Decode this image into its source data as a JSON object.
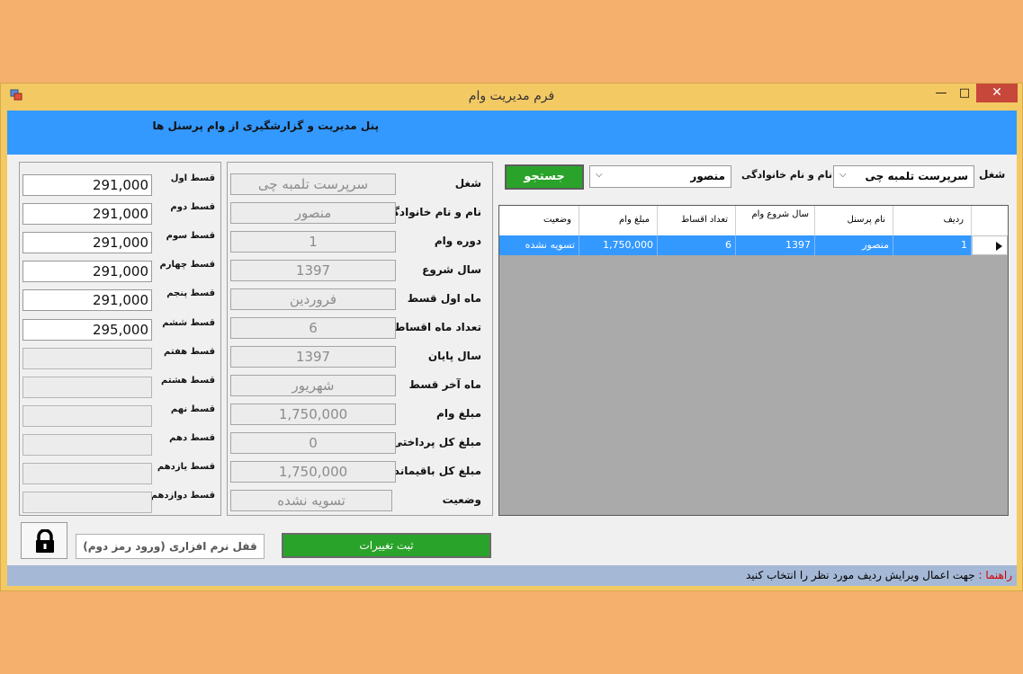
{
  "window": {
    "title": "فرم مدیریت وام",
    "controls": {
      "minimize": "—",
      "maximize": "□",
      "close": "✕"
    }
  },
  "banner": {
    "text": "پنل مدیریت و گزارشگیری از وام پرسنل ها"
  },
  "search": {
    "job_label": "شغل",
    "job_value": "سرپرست تلمبه چی",
    "name_label": "نام و نام خانوادگی",
    "name_value": "منصور",
    "button": "جستجو"
  },
  "grid": {
    "columns": [
      "ردیف",
      "نام پرسنل",
      "سال شروع وام",
      "تعداد اقساط",
      "مبلغ وام",
      "وضعیت"
    ],
    "rows": [
      {
        "index": "1",
        "name": "منصور",
        "start_year": "1397",
        "count": "6",
        "amount": "1,750,000",
        "status": "تسویه نشده"
      }
    ]
  },
  "details": {
    "fields": [
      {
        "label": "شغل",
        "value": "سرپرست تلمبه چی"
      },
      {
        "label": "نام و نام خانوادگی",
        "value": "منصور"
      },
      {
        "label": "دوره وام",
        "value": "1"
      },
      {
        "label": "سال شروع",
        "value": "1397"
      },
      {
        "label": "ماه اول قسط",
        "value": "فروردین"
      },
      {
        "label": "تعداد ماه اقساط",
        "value": "6"
      },
      {
        "label": "سال پایان",
        "value": "1397"
      },
      {
        "label": "ماه آخر قسط",
        "value": "شهریور"
      },
      {
        "label": "مبلغ وام",
        "value": "1,750,000"
      },
      {
        "label": "مبلغ کل پرداختی",
        "value": "0"
      },
      {
        "label": "مبلغ کل باقیمانده",
        "value": "1,750,000"
      },
      {
        "label": "وضعیت",
        "value": "تسویه نشده"
      }
    ]
  },
  "installments": {
    "items": [
      {
        "label": "قسط اول",
        "value": "291,000"
      },
      {
        "label": "قسط دوم",
        "value": "291,000"
      },
      {
        "label": "قسط سوم",
        "value": "291,000"
      },
      {
        "label": "قسط چهارم",
        "value": "291,000"
      },
      {
        "label": "قسط پنجم",
        "value": "291,000"
      },
      {
        "label": "قسط ششم",
        "value": "295,000"
      },
      {
        "label": "قسط هفتم",
        "value": ""
      },
      {
        "label": "قسط هشتم",
        "value": ""
      },
      {
        "label": "قسط نهم",
        "value": ""
      },
      {
        "label": "قسط دهم",
        "value": ""
      },
      {
        "label": "قسط یازدهم",
        "value": ""
      },
      {
        "label": "قسط دوازدهم",
        "value": ""
      }
    ]
  },
  "actions": {
    "lock_label": "قفل نرم افزاری (ورود رمز دوم)",
    "save_label": "ثبت تغییرات"
  },
  "status": {
    "prefix": "راهنما :",
    "text": "جهت اعمال ویرایش ردیف مورد نظر را انتخاب کنید"
  }
}
